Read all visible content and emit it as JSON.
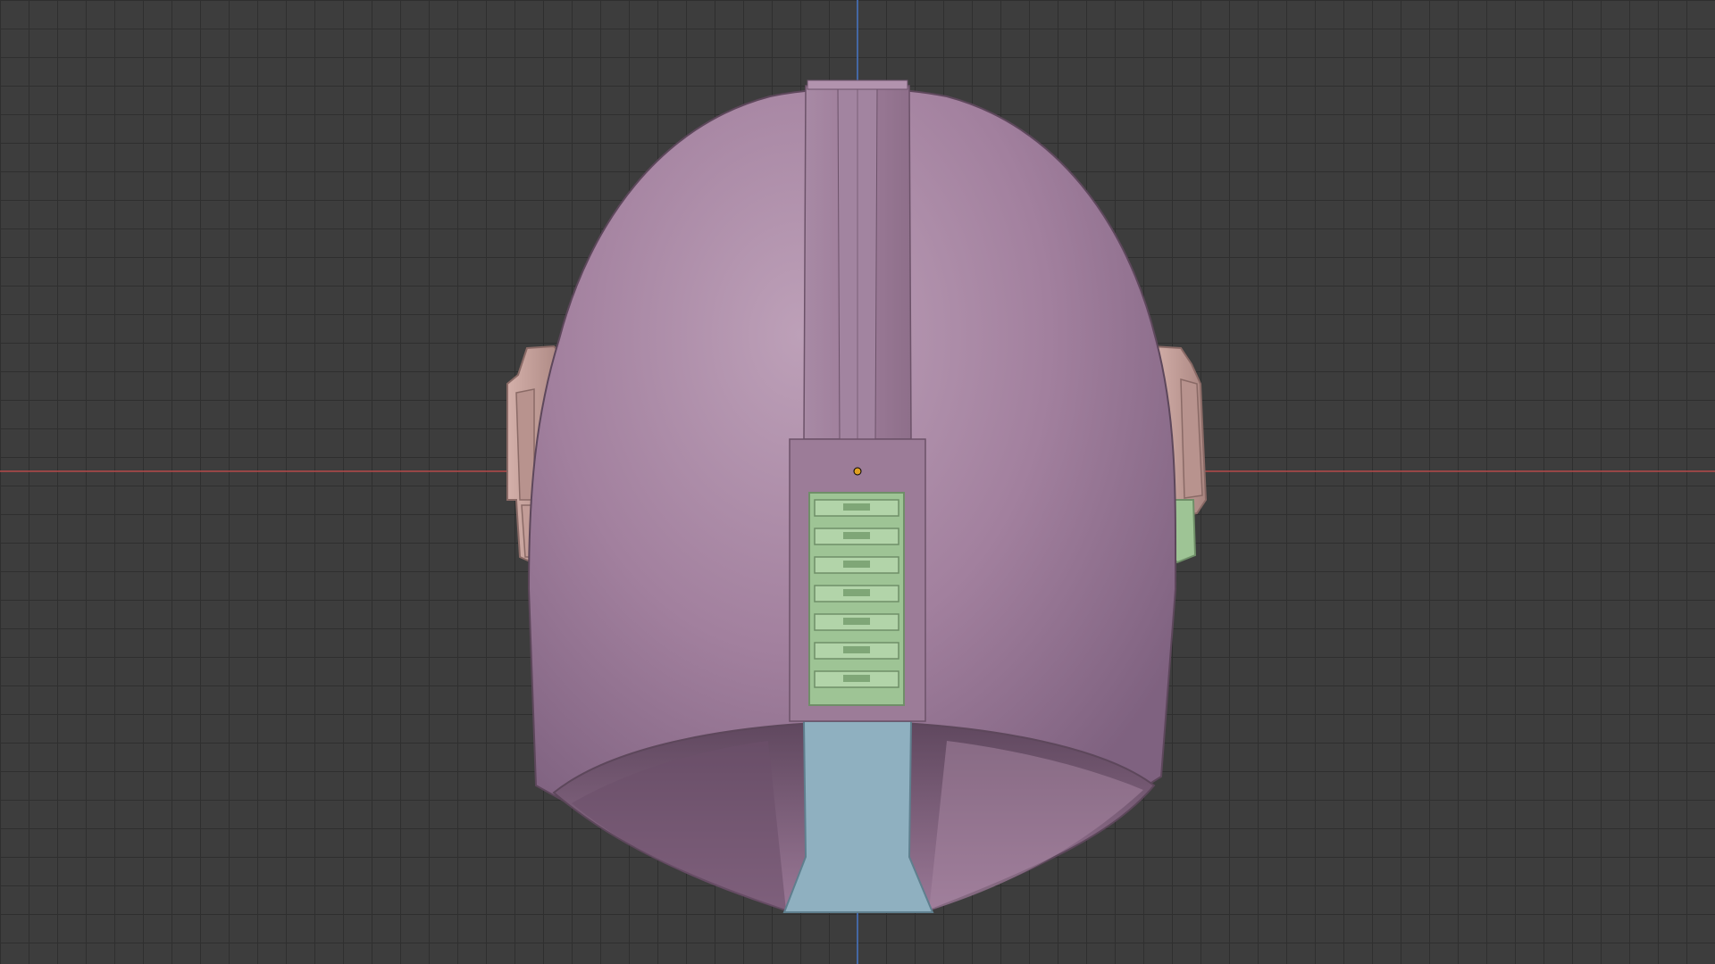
{
  "viewport": {
    "kind": "3d-viewport",
    "view": "orthographic",
    "grid": true,
    "background_color": "#3d3d3d",
    "grid_color": "#2f2f2f"
  },
  "axes": {
    "x_axis_color": "#b54a4a",
    "z_axis_color": "#4a78c8"
  },
  "model": {
    "object": "helmet",
    "parts": [
      {
        "name": "dome",
        "color": "#a07f9c"
      },
      {
        "name": "rear-fin-strip",
        "color": "#9a7996"
      },
      {
        "name": "rear-vent-panel",
        "color": "#9ec495"
      },
      {
        "name": "ear-cap-left",
        "color": "#c8a39e"
      },
      {
        "name": "ear-cap-right",
        "color": "#c8a39e"
      },
      {
        "name": "ear-tab-right",
        "color": "#9ec495"
      },
      {
        "name": "inner-visor-strip",
        "color": "#8fb0c0"
      },
      {
        "name": "inner-shell",
        "color": "#7f5f7c"
      }
    ]
  },
  "origin": {
    "color": "#e0a020"
  }
}
